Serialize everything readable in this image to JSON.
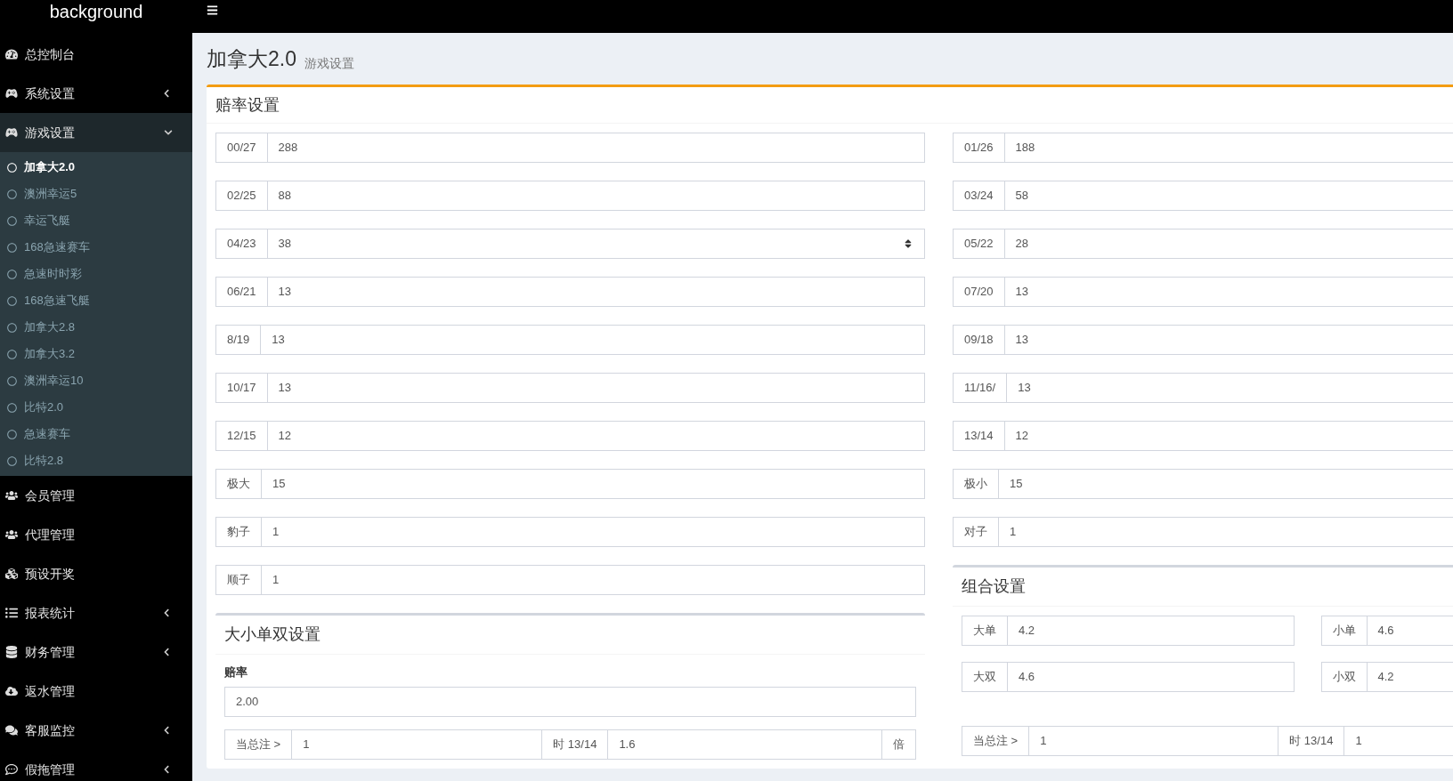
{
  "topbar": {
    "logo": "background"
  },
  "sidebar": {
    "items": [
      {
        "label": "总控制台",
        "collapsible": false,
        "expanded": false
      },
      {
        "label": "系统设置",
        "collapsible": true,
        "expanded": false
      },
      {
        "label": "游戏设置",
        "collapsible": true,
        "expanded": true,
        "children": [
          {
            "label": "加拿大2.0",
            "selected": true
          },
          {
            "label": "澳洲幸运5",
            "selected": false
          },
          {
            "label": "幸运飞艇",
            "selected": false
          },
          {
            "label": "168急速赛车",
            "selected": false
          },
          {
            "label": "急速时时彩",
            "selected": false
          },
          {
            "label": "168急速飞艇",
            "selected": false
          },
          {
            "label": "加拿大2.8",
            "selected": false
          },
          {
            "label": "加拿大3.2",
            "selected": false
          },
          {
            "label": "澳洲幸运10",
            "selected": false
          },
          {
            "label": "比特2.0",
            "selected": false
          },
          {
            "label": "急速赛车",
            "selected": false
          },
          {
            "label": "比特2.8",
            "selected": false
          }
        ]
      },
      {
        "label": "会员管理",
        "collapsible": false,
        "expanded": false
      },
      {
        "label": "代理管理",
        "collapsible": false,
        "expanded": false
      },
      {
        "label": "预设开奖",
        "collapsible": false,
        "expanded": false
      },
      {
        "label": "报表统计",
        "collapsible": true,
        "expanded": false
      },
      {
        "label": "财务管理",
        "collapsible": true,
        "expanded": false
      },
      {
        "label": "返水管理",
        "collapsible": false,
        "expanded": false
      },
      {
        "label": "客服监控",
        "collapsible": true,
        "expanded": false
      },
      {
        "label": "假拖管理",
        "collapsible": true,
        "expanded": false
      }
    ]
  },
  "page_header": {
    "title": "加拿大2.0",
    "subtitle": "游戏设置"
  },
  "odds_settings": {
    "title": "赔率设置",
    "left_fields": [
      {
        "label": "00/27",
        "value": "288",
        "spinner": false
      },
      {
        "label": "02/25",
        "value": "88",
        "spinner": false
      },
      {
        "label": "04/23",
        "value": "38",
        "spinner": true
      },
      {
        "label": "06/21",
        "value": "13",
        "spinner": false
      },
      {
        "label": "8/19",
        "value": "13",
        "spinner": false
      },
      {
        "label": "10/17",
        "value": "13",
        "spinner": false
      },
      {
        "label": "12/15",
        "value": "12",
        "spinner": false
      },
      {
        "label": "极大",
        "value": "15",
        "spinner": false
      },
      {
        "label": "豹子",
        "value": "1",
        "spinner": false
      },
      {
        "label": "顺子",
        "value": "1",
        "spinner": false
      }
    ],
    "right_fields": [
      {
        "label": "01/26",
        "value": "188"
      },
      {
        "label": "03/24",
        "value": "58"
      },
      {
        "label": "05/22",
        "value": "28"
      },
      {
        "label": "07/20",
        "value": "13"
      },
      {
        "label": "09/18",
        "value": "13"
      },
      {
        "label": "11/16/",
        "value": "13"
      },
      {
        "label": "13/14",
        "value": "12"
      },
      {
        "label": "极小",
        "value": "15"
      },
      {
        "label": "对子",
        "value": "1"
      }
    ]
  },
  "size_parity": {
    "title": "大小单双设置",
    "odds_label": "赔率",
    "odds_value": "2.00",
    "rule": {
      "prefix": "当总注 >",
      "amount": "1",
      "middle": "时 13/14",
      "multiplier": "1.6",
      "suffix": "倍"
    }
  },
  "combo": {
    "title": "组合设置",
    "items": [
      {
        "label": "大单",
        "value": "4.2"
      },
      {
        "label": "小单",
        "value": "4.6"
      },
      {
        "label": "大双",
        "value": "4.6"
      },
      {
        "label": "小双",
        "value": "4.2"
      }
    ],
    "rule": {
      "prefix": "当总注 >",
      "amount": "1",
      "middle": "时 13/14",
      "multiplier": "1"
    }
  }
}
